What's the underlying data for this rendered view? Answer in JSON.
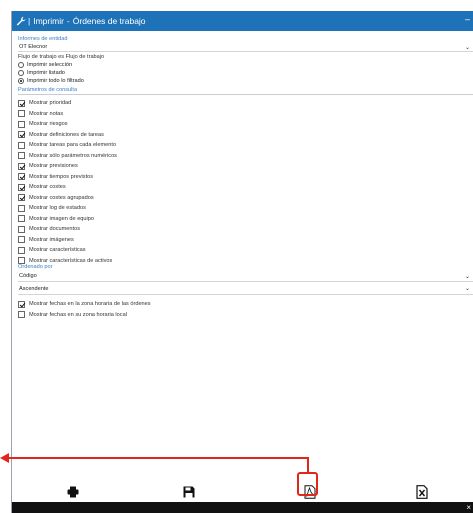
{
  "window": {
    "title_icon": "wrench-icon",
    "title_prefix": "Imprimir",
    "title_separator": "-",
    "title": "Órdenes de trabajo",
    "minimize": "–"
  },
  "entity_reports": {
    "label": "Informes de entidad",
    "value": "OT Elecnor"
  },
  "workflow": {
    "label": "Flujo de trabajo es Flujo de trabajo",
    "options": [
      {
        "label": "Imprimir selección",
        "selected": false
      },
      {
        "label": "Imprimir listado",
        "selected": false
      },
      {
        "label": "Imprimir todo lo filtrado",
        "selected": true
      }
    ]
  },
  "query_params": {
    "label": "Parámetros de consulta",
    "items": [
      {
        "label": "Mostrar prioridad",
        "checked": true
      },
      {
        "label": "Mostrar notas",
        "checked": false
      },
      {
        "label": "Mostrar riesgos",
        "checked": false
      },
      {
        "label": "Mostrar definiciones de tareas",
        "checked": true
      },
      {
        "label": "Mostrar tareas para cada elemento",
        "checked": false
      },
      {
        "label": "Mostrar sólo parámetros numéricos",
        "checked": false
      },
      {
        "label": "Mostrar previsiones",
        "checked": true
      },
      {
        "label": "Mostrar tiempos previstos",
        "checked": true
      },
      {
        "label": "Mostrar costes",
        "checked": true
      },
      {
        "label": "Mostrar costes agrupados",
        "checked": true
      },
      {
        "label": "Mostrar log de estados",
        "checked": false
      },
      {
        "label": "Mostrar imagen de equipo",
        "checked": false
      },
      {
        "label": "Mostrar documentos",
        "checked": false
      },
      {
        "label": "Mostrar imágenes",
        "checked": false
      },
      {
        "label": "Mostrar características",
        "checked": false
      },
      {
        "label": "Mostrar características de activos",
        "checked": false
      }
    ]
  },
  "order_by": {
    "label": "Ordenado por",
    "field": "Código",
    "direction": "Ascendente"
  },
  "timezone": [
    {
      "label": "Mostrar fechas en la zona horaria de las órdenes",
      "checked": true
    },
    {
      "label": "Mostrar fechas en su zona horaria local",
      "checked": false
    }
  ],
  "toolbar": {
    "print": "printer-icon",
    "save": "save-icon",
    "pdf": "pdf-icon",
    "excel": "excel-icon",
    "highlight_color": "#e1261c"
  },
  "bottombar": {
    "close": "×"
  },
  "colors": {
    "titlebar": "#1e73b8",
    "section": "#3d7ec4",
    "annotation": "#e1261c"
  }
}
